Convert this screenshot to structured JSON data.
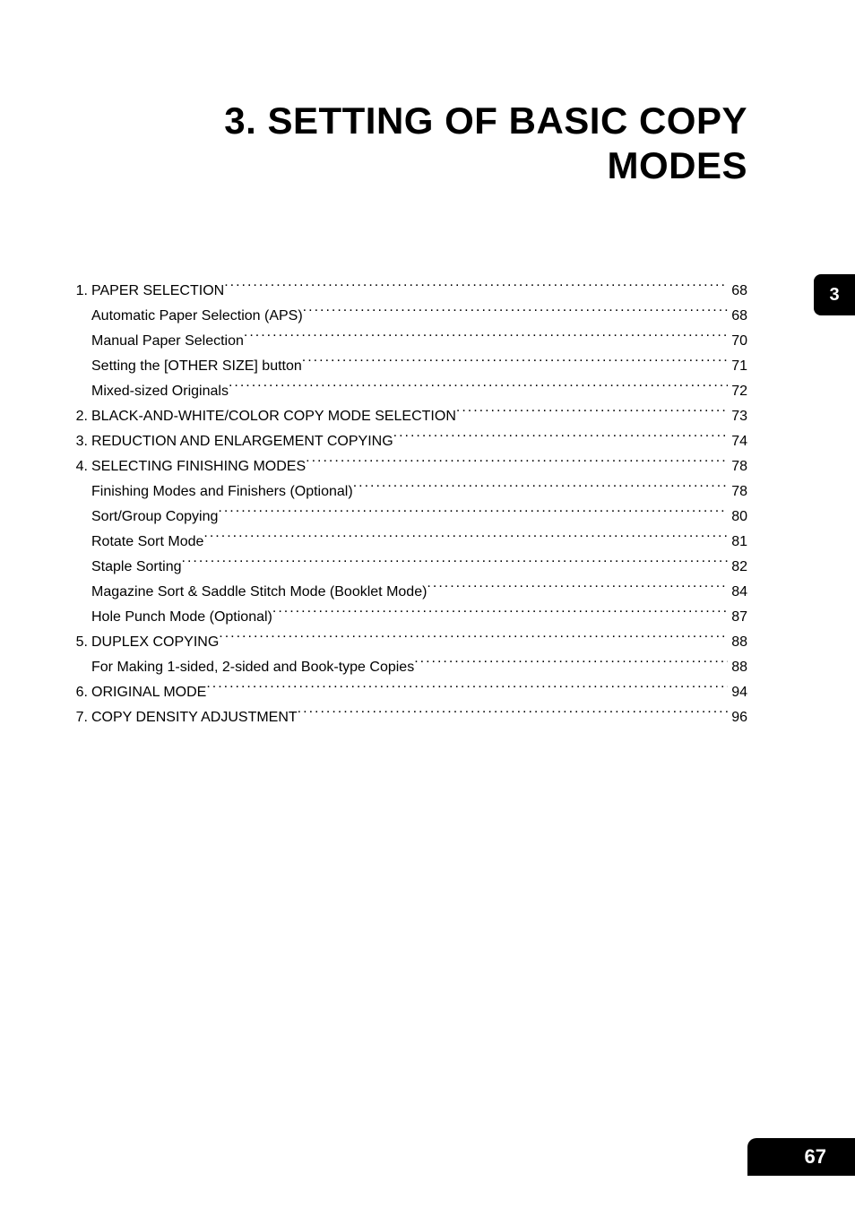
{
  "title_line1": "3. SETTING OF BASIC COPY",
  "title_line2": "MODES",
  "side_tab": "3",
  "page_number": "67",
  "toc": [
    {
      "num": "1.",
      "label": "PAPER SELECTION",
      "page": "68",
      "sub": false
    },
    {
      "num": "",
      "label": "Automatic Paper Selection (APS)",
      "page": "68",
      "sub": true
    },
    {
      "num": "",
      "label": "Manual Paper Selection",
      "page": "70",
      "sub": true
    },
    {
      "num": "",
      "label": "Setting the [OTHER SIZE] button",
      "page": "71",
      "sub": true
    },
    {
      "num": "",
      "label": "Mixed-sized Originals",
      "page": "72",
      "sub": true
    },
    {
      "num": "2.",
      "label": "BLACK-AND-WHITE/COLOR COPY MODE SELECTION",
      "page": "73",
      "sub": false
    },
    {
      "num": "3.",
      "label": "REDUCTION AND ENLARGEMENT COPYING",
      "page": "74",
      "sub": false
    },
    {
      "num": "4.",
      "label": "SELECTING FINISHING MODES",
      "page": "78",
      "sub": false
    },
    {
      "num": "",
      "label": "Finishing Modes and Finishers (Optional)",
      "page": "78",
      "sub": true
    },
    {
      "num": "",
      "label": "Sort/Group Copying",
      "page": "80",
      "sub": true
    },
    {
      "num": "",
      "label": "Rotate Sort Mode",
      "page": "81",
      "sub": true
    },
    {
      "num": "",
      "label": "Staple Sorting",
      "page": "82",
      "sub": true
    },
    {
      "num": "",
      "label": "Magazine Sort & Saddle Stitch Mode (Booklet Mode)",
      "page": "84",
      "sub": true
    },
    {
      "num": "",
      "label": "Hole Punch Mode (Optional)",
      "page": "87",
      "sub": true
    },
    {
      "num": "5.",
      "label": "DUPLEX COPYING",
      "page": "88",
      "sub": false
    },
    {
      "num": "",
      "label": "For Making 1-sided, 2-sided and Book-type Copies",
      "page": "88",
      "sub": true
    },
    {
      "num": "6.",
      "label": "ORIGINAL MODE",
      "page": "94",
      "sub": false
    },
    {
      "num": "7.",
      "label": "COPY DENSITY ADJUSTMENT",
      "page": "96",
      "sub": false
    }
  ]
}
